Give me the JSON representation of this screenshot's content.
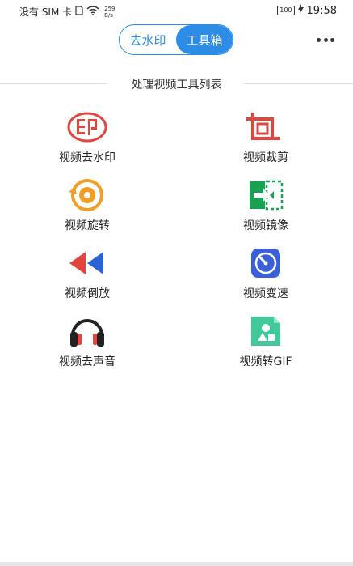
{
  "status_bar": {
    "carrier": "没有 SIM 卡",
    "net_speed_value": "259",
    "net_speed_unit": "B/s",
    "battery": "100",
    "time": "19:58"
  },
  "segmented": {
    "tab1": "去水印",
    "tab2": "工具箱",
    "active": "工具箱"
  },
  "section_title": "处理视频工具列表",
  "tools": [
    {
      "label": "视频去水印",
      "icon": "watermark-stamp-icon",
      "color": "#e0453e"
    },
    {
      "label": "视频裁剪",
      "icon": "crop-icon",
      "color": "#e0453e"
    },
    {
      "label": "视频旋转",
      "icon": "rotate-disc-icon",
      "color": "#f29d24"
    },
    {
      "label": "视频镜像",
      "icon": "mirror-icon",
      "color": "#1aa052"
    },
    {
      "label": "视频倒放",
      "icon": "reverse-play-icon",
      "color": "#e0453e"
    },
    {
      "label": "视频变速",
      "icon": "speedometer-icon",
      "color": "#3a5fd9"
    },
    {
      "label": "视频去声音",
      "icon": "headphones-icon",
      "color": "#e0453e"
    },
    {
      "label": "视频转GIF",
      "icon": "gif-shapes-icon",
      "color": "#41c99a"
    }
  ]
}
